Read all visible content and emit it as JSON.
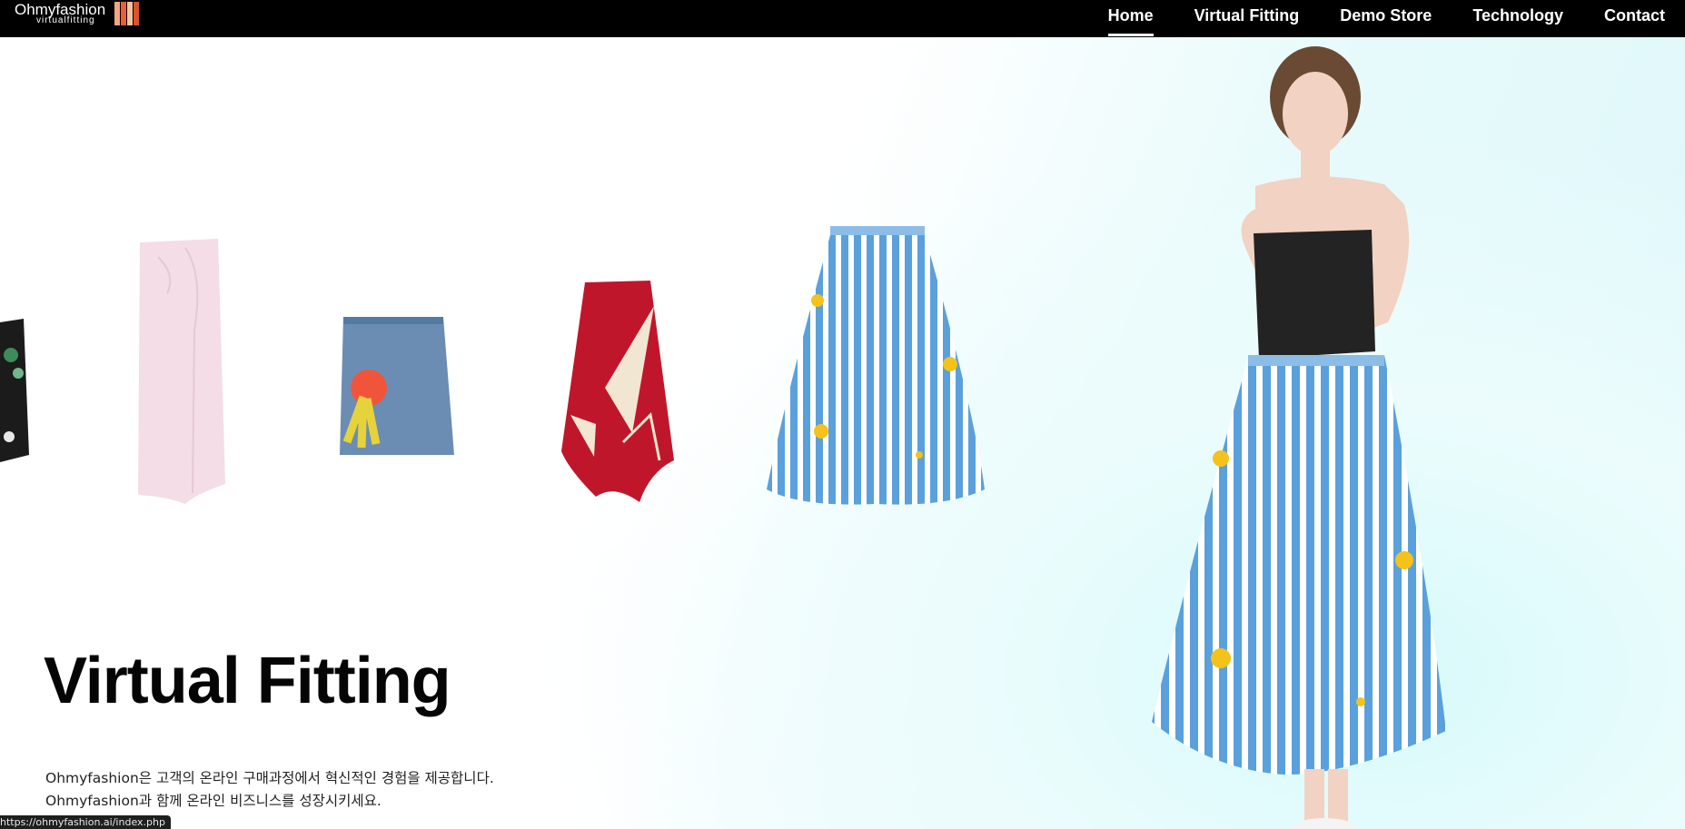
{
  "brand": {
    "name": "Ohmyfashion",
    "tagline": "virtualfitting",
    "bar_colors": [
      "#f4a582",
      "#e8602c",
      "#f7c2a0",
      "#d9562a"
    ]
  },
  "nav": {
    "items": [
      {
        "label": "Home",
        "active": true
      },
      {
        "label": "Virtual Fitting",
        "active": false
      },
      {
        "label": "Demo Store",
        "active": false
      },
      {
        "label": "Technology",
        "active": false
      },
      {
        "label": "Contact",
        "active": false
      }
    ]
  },
  "hero": {
    "title": "Virtual Fitting",
    "subtitle_line1": "Ohmyfashion은 고객의 온라인 구매과정에서 혁신적인 경험을 제공합니다.",
    "subtitle_line2": "Ohmyfashion과 함께 온라인 비즈니스를 성장시키세요."
  },
  "products": [
    {
      "name": "floral-print-black-skirt",
      "color": "#1b1b1b"
    },
    {
      "name": "pink-wrap-skirt",
      "color": "#f4dde6"
    },
    {
      "name": "denim-mini-skirt",
      "color": "#6b8db3"
    },
    {
      "name": "red-asymmetric-skirt",
      "color": "#c0162b"
    },
    {
      "name": "blue-striped-midi-skirt",
      "color": "#5aa0dc"
    }
  ],
  "model": {
    "top_color": "#232323",
    "skirt_color": "#5aa0dc",
    "skin_color": "#f2d2c2",
    "hair_color": "#6b4a34"
  },
  "status_url": "https://ohmyfashion.ai/index.php"
}
